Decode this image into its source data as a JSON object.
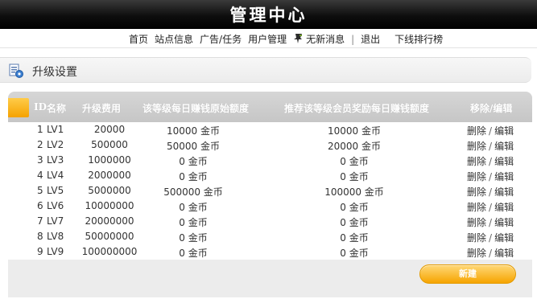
{
  "header": {
    "title": "管理中心"
  },
  "nav": {
    "items": [
      "首页",
      "站点信息",
      "广告/任务",
      "用户管理"
    ],
    "messages": "无新消息",
    "separator": "|",
    "logout": "退出",
    "ranking": "下线排行榜"
  },
  "section": {
    "title": "升级设置"
  },
  "table": {
    "headers": {
      "id": "ID",
      "name": "名称",
      "cost": "升级费用",
      "daily": "该等级每日赚钱原始额度",
      "referral": "推荐该等级会员奖励每日赚钱额度",
      "actions": "移除/编辑"
    },
    "delete_label": "删除",
    "edit_label": "编辑",
    "action_sep": "/",
    "rows": [
      {
        "id": "1",
        "name": "LV1",
        "cost": "20000",
        "daily": "10000 金币",
        "referral": "10000 金币"
      },
      {
        "id": "2",
        "name": "LV2",
        "cost": "500000",
        "daily": "50000 金币",
        "referral": "20000 金币"
      },
      {
        "id": "3",
        "name": "LV3",
        "cost": "1000000",
        "daily": "0 金币",
        "referral": "0 金币"
      },
      {
        "id": "4",
        "name": "LV4",
        "cost": "2000000",
        "daily": "0 金币",
        "referral": "0 金币"
      },
      {
        "id": "5",
        "name": "LV5",
        "cost": "5000000",
        "daily": "500000 金币",
        "referral": "100000 金币"
      },
      {
        "id": "6",
        "name": "LV6",
        "cost": "10000000",
        "daily": "0 金币",
        "referral": "0 金币"
      },
      {
        "id": "7",
        "name": "LV7",
        "cost": "20000000",
        "daily": "0 金币",
        "referral": "0 金币"
      },
      {
        "id": "8",
        "name": "LV8",
        "cost": "50000000",
        "daily": "0 金币",
        "referral": "0 金币"
      },
      {
        "id": "9",
        "name": "LV9",
        "cost": "100000000",
        "daily": "0 金币",
        "referral": "0 金币"
      }
    ]
  },
  "add_button": {
    "label": "新建"
  }
}
